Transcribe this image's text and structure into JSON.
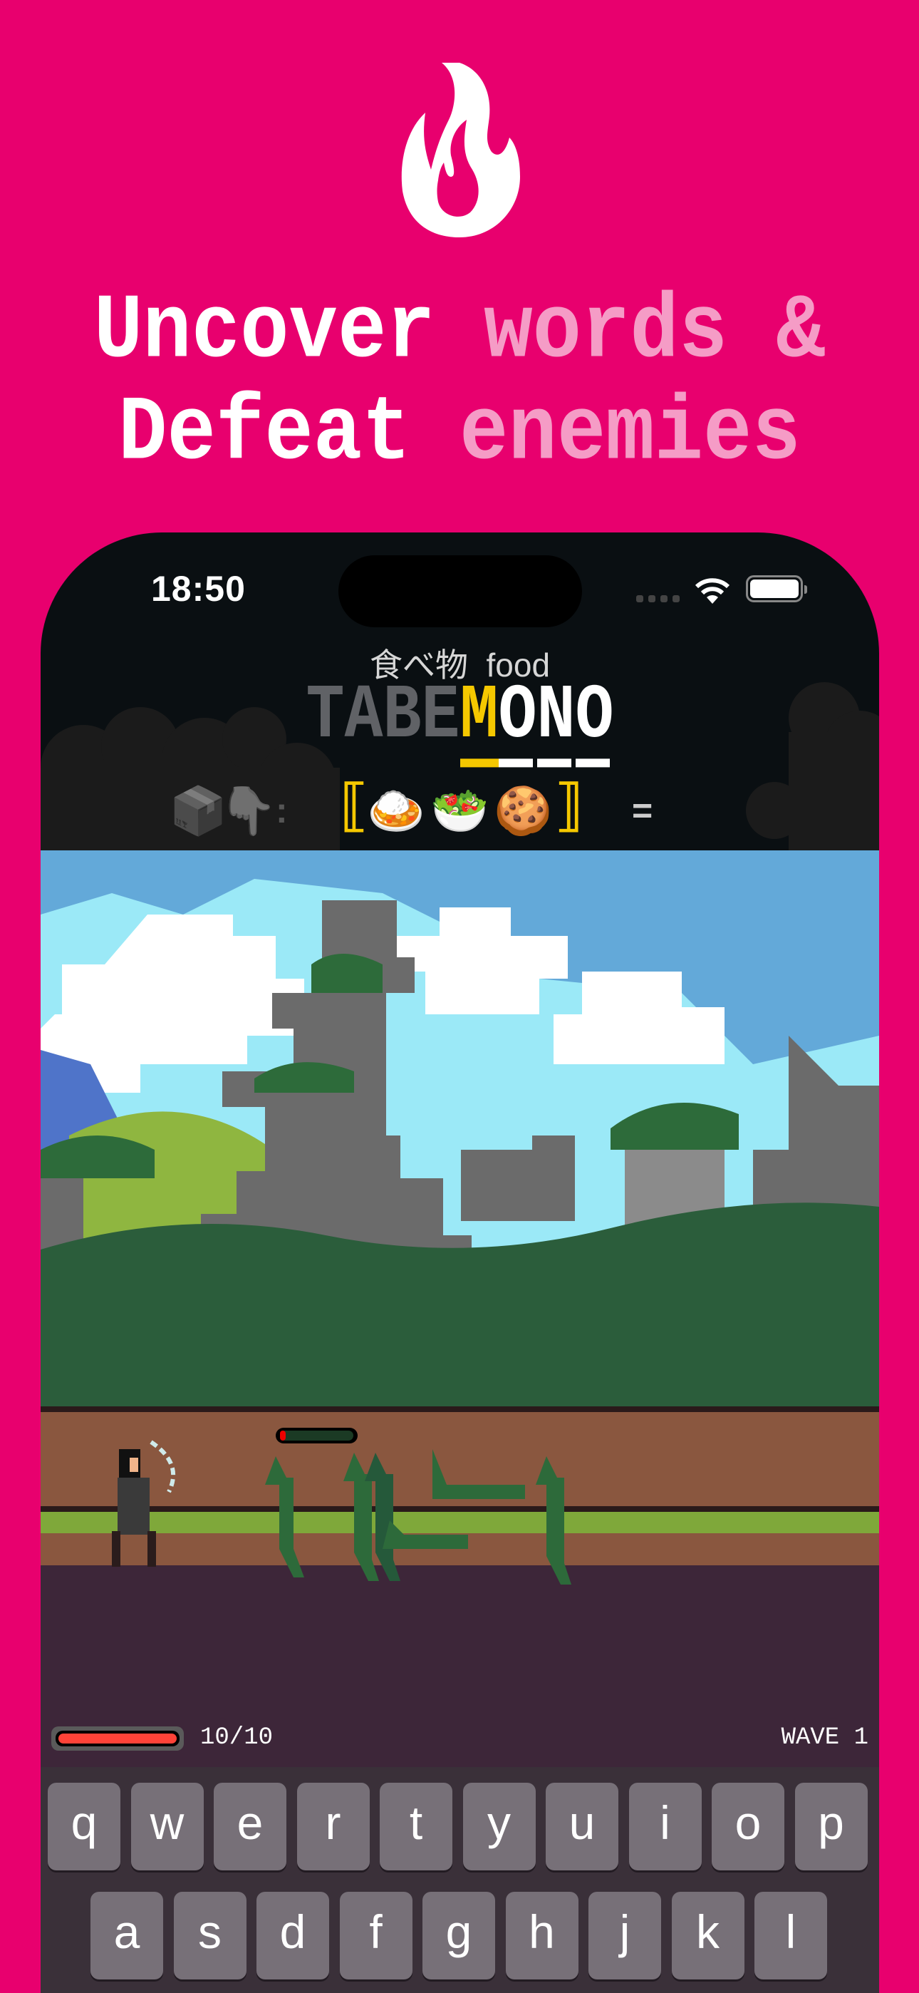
{
  "promo": {
    "icon": "flame-icon",
    "line1": {
      "white": "Uncover",
      "pink": "words &"
    },
    "line2": {
      "white": "Defeat",
      "pink": "enemies"
    },
    "colors": {
      "background": "#e8006e",
      "highlight": "#f59cc6"
    }
  },
  "status_bar": {
    "time": "18:50"
  },
  "game": {
    "subtitle": "食べ物  food",
    "word": {
      "revealed": "TABE",
      "current": "M",
      "remaining": "ONO"
    },
    "hint": {
      "icons": [
        "📦",
        "👇"
      ],
      "colon": ":",
      "open": "⟦",
      "emojis": [
        "🍛",
        "🥗",
        "🍪"
      ],
      "close": "⟧",
      "equals": "="
    },
    "hp": {
      "text": "10/10",
      "fraction": 1.0
    },
    "enemy_hp_fraction": 0.05,
    "wave": "WAVE 1"
  },
  "keyboard": {
    "row1": [
      "q",
      "w",
      "e",
      "r",
      "t",
      "y",
      "u",
      "i",
      "o",
      "p"
    ],
    "row2": [
      "a",
      "s",
      "d",
      "f",
      "g",
      "h",
      "j",
      "k",
      "l"
    ]
  }
}
